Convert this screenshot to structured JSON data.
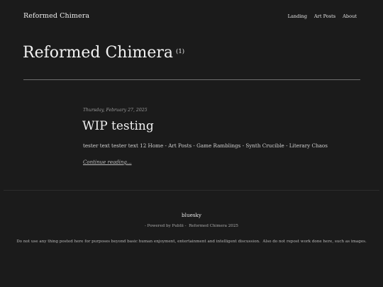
{
  "header": {
    "site_title": "Reformed Chimera",
    "nav": [
      {
        "label": "Landing"
      },
      {
        "label": "Art Posts"
      },
      {
        "label": "About"
      }
    ]
  },
  "page": {
    "title": "Reformed Chimera",
    "count": "(1)"
  },
  "post": {
    "date": "Thursday, February 27, 2025",
    "title": "WIP testing",
    "excerpt": "tester text tester text 12 Home - Art Posts - Game Ramblings - Synth Crucible - Literary Chaos",
    "continue_label": "Continue reading..."
  },
  "footer": {
    "link": "bluesky",
    "powered": "- Powered by Publii -  Reformed Chimera 2025",
    "disclaimer": "Do not use any thing posted here for purposes beyond basic human enjoyment, entertainment and intelligent discussion.  Also do not repost work done here, such as images."
  }
}
